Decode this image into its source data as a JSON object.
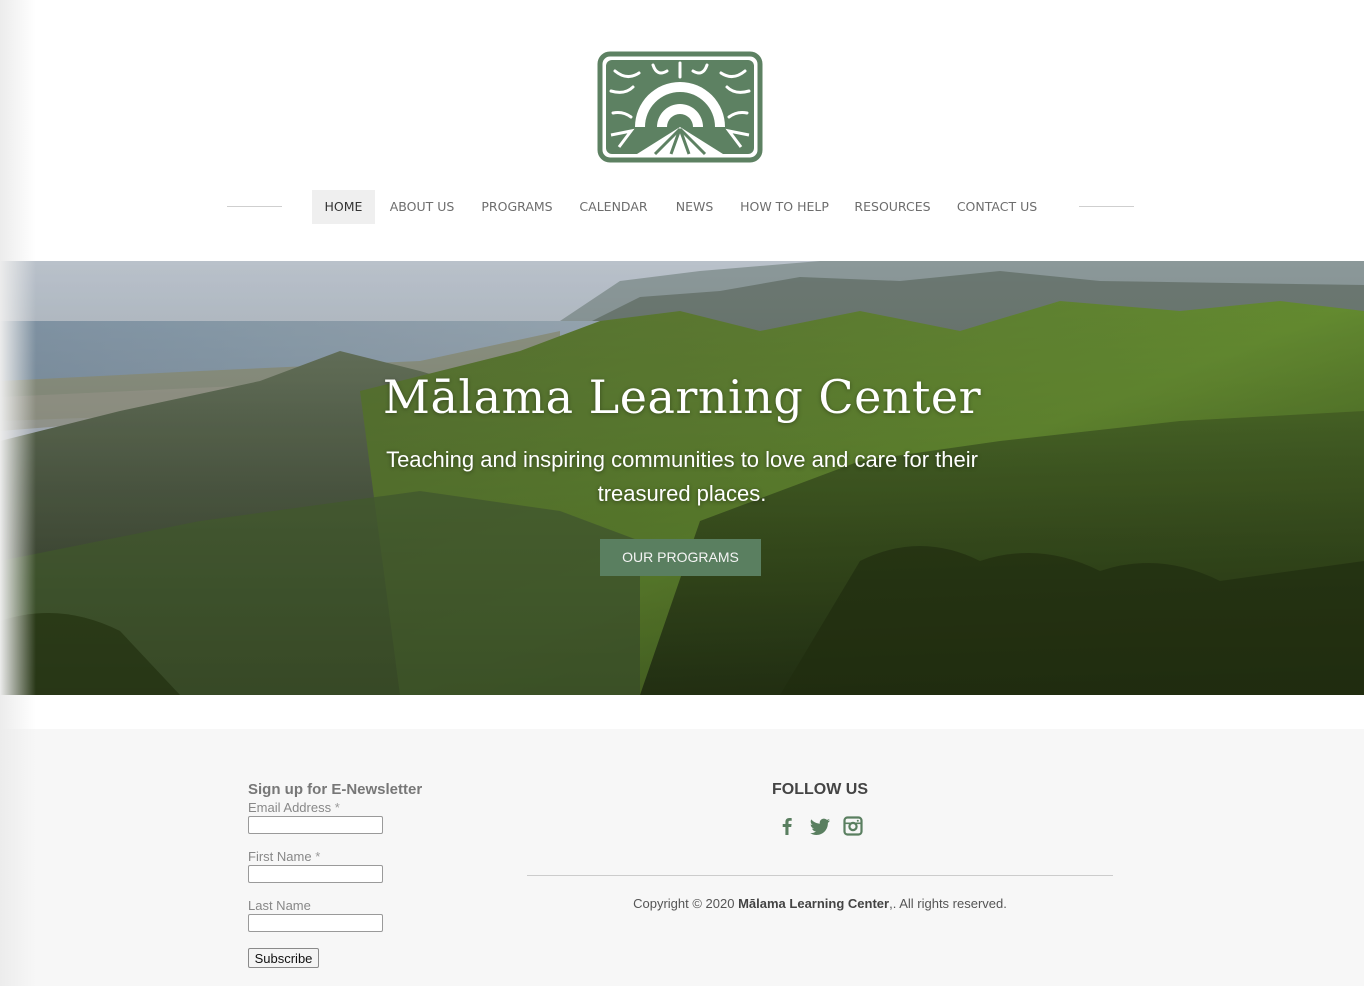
{
  "header": {
    "logo_name": "malama-sunrise-logo",
    "nav": [
      {
        "label": "HOME",
        "active": true
      },
      {
        "label": "ABOUT US",
        "active": false
      },
      {
        "label": "PROGRAMS",
        "active": false
      },
      {
        "label": "CALENDAR",
        "active": false
      },
      {
        "label": "NEWS",
        "active": false
      },
      {
        "label": "HOW TO HELP",
        "active": false
      },
      {
        "label": "RESOURCES",
        "active": false
      },
      {
        "label": "CONTACT US",
        "active": false
      }
    ]
  },
  "hero": {
    "title": "Mālama Learning Center",
    "subtitle": "Teaching and inspiring communities to love and care for their treasured places.",
    "button_label": "OUR PROGRAMS"
  },
  "newsletter": {
    "title": "Sign up for E-Newsletter",
    "email_label": "Email Address",
    "first_name_label": "First Name",
    "last_name_label": "Last Name",
    "required_mark": "*",
    "subscribe_label": "Subscribe"
  },
  "follow": {
    "title": "FOLLOW US",
    "icons": [
      "facebook-icon",
      "twitter-icon",
      "instagram-icon"
    ]
  },
  "copyright": {
    "prefix": "Copyright © 2020 ",
    "org": "Mālama Learning Center",
    "suffix": ",. All rights reserved."
  },
  "colors": {
    "brand_green": "#5a7f60",
    "logo_green": "#5d8162",
    "footer_bg": "#f7f7f7"
  }
}
